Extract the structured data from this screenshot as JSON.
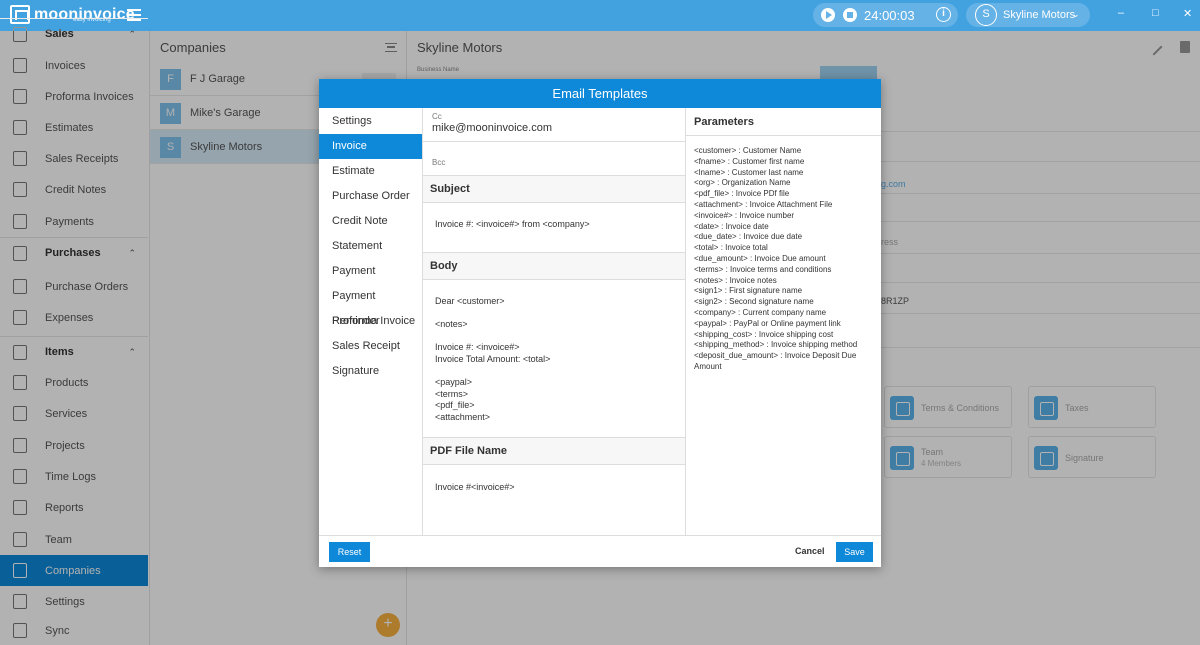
{
  "app": {
    "name": "mooninvoice",
    "tagline": "easy invoicing"
  },
  "timer": {
    "time": "24:00:03"
  },
  "user": {
    "initial": "S",
    "name": "Skyline Motors"
  },
  "sidebar": {
    "items": [
      {
        "label": "Sales",
        "section": true
      },
      {
        "label": "Invoices"
      },
      {
        "label": "Proforma Invoices"
      },
      {
        "label": "Estimates"
      },
      {
        "label": "Sales Receipts"
      },
      {
        "label": "Credit Notes"
      },
      {
        "label": "Payments"
      },
      {
        "label": "Purchases",
        "section": true
      },
      {
        "label": "Purchase Orders"
      },
      {
        "label": "Expenses"
      },
      {
        "label": "Items",
        "section": true
      },
      {
        "label": "Products"
      },
      {
        "label": "Services"
      },
      {
        "label": "Projects"
      },
      {
        "label": "Time Logs"
      },
      {
        "label": "Reports"
      },
      {
        "label": "Team"
      },
      {
        "label": "Companies",
        "active": true
      },
      {
        "label": "Settings"
      },
      {
        "label": "Sync"
      }
    ]
  },
  "companies": {
    "title": "Companies",
    "list": [
      {
        "initial": "F",
        "name": "F J Garage"
      },
      {
        "initial": "M",
        "name": "Mike's Garage"
      },
      {
        "initial": "S",
        "name": "Skyline Motors"
      }
    ],
    "fab": "+"
  },
  "main": {
    "title": "Skyline Motors",
    "business_name_label": "Business Name",
    "bg_fragments": {
      "email": "g.com",
      "address": "ress",
      "code": "8R1ZP"
    },
    "tiles": [
      {
        "label": "Terms & Conditions"
      },
      {
        "label": "Taxes"
      },
      {
        "label": "Team",
        "sub": "4 Members"
      },
      {
        "label": "Signature"
      }
    ]
  },
  "modal": {
    "title": "Email Templates",
    "nav": [
      "Settings",
      "Invoice",
      "Estimate",
      "Purchase Order",
      "Credit Note",
      "Statement",
      "Payment",
      "Payment Reminder",
      "Proforma Invoice",
      "Sales Receipt",
      "Signature"
    ],
    "selected_nav": "Invoice",
    "cc_label": "Cc",
    "cc_value": "mike@mooninvoice.com",
    "bcc_label": "Bcc",
    "subject_label": "Subject",
    "subject_value": "Invoice #: <invoice#> from <company>",
    "body_label": "Body",
    "body_value": "Dear <customer>\n\n<notes>\n\nInvoice #: <invoice#>\nInvoice Total Amount: <total>\n\n<paypal>\n<terms>\n<pdf_file>\n<attachment>",
    "pdf_label": "PDF File Name",
    "pdf_value": "Invoice #<invoice#>",
    "params_label": "Parameters",
    "params_value": "<customer> : Customer Name\n<fname> : Customer first name\n<lname> : Customer last name\n<org> : Organization Name\n<pdf_file> : Invoice PDf file\n<attachment> : Invoice Attachment File\n<invoice#> : Invoice number\n<date> : Invoice date\n<due_date> : Invoice due date\n<total> : Invoice total\n<due_amount> : Invoice Due amount\n<terms> : Invoice terms and conditions\n<notes> : Invoice notes\n<sign1> : First signature name\n<sign2> : Second signature name\n<company> : Current company name\n<paypal> : PayPal or Online payment link\n<shipping_cost> : Invoice shipping cost\n<shipping_method> : Invoice shipping method\n<deposit_due_amount> : Invoice Deposit Due Amount",
    "reset": "Reset",
    "cancel": "Cancel",
    "save": "Save"
  },
  "colors": {
    "accent": "#0e88d8",
    "fab": "#f7b040"
  }
}
